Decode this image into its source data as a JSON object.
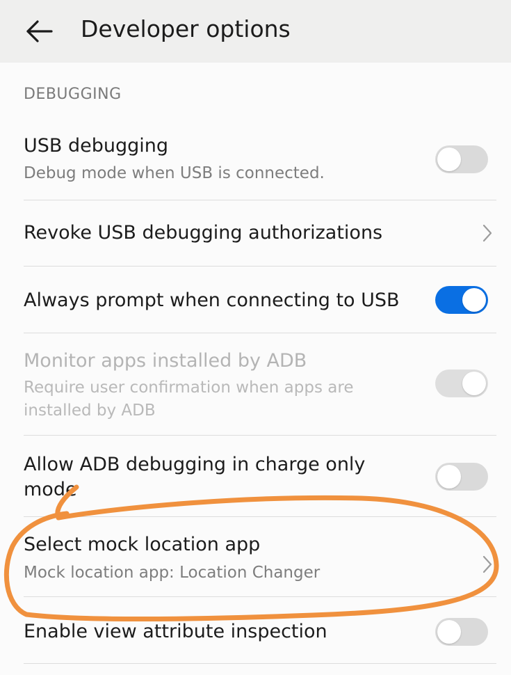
{
  "header": {
    "title": "Developer options",
    "back_icon": "arrow-left-icon"
  },
  "section": {
    "label": "DEBUGGING"
  },
  "rows": [
    {
      "title": "USB debugging",
      "subtitle": "Debug mode when USB is connected.",
      "control": "toggle",
      "state": "off"
    },
    {
      "title": "Revoke USB debugging authorizations",
      "control": "chevron"
    },
    {
      "title": "Always prompt when connecting to USB",
      "control": "toggle",
      "state": "on"
    },
    {
      "title": "Monitor apps installed by ADB",
      "subtitle_line1": "Require user confirmation when apps are",
      "subtitle_line2": "installed by ADB",
      "control": "toggle",
      "state": "on",
      "enabled": false
    },
    {
      "title_line1": "Allow ADB debugging in charge only",
      "title_line2": "mode",
      "control": "toggle",
      "state": "off"
    },
    {
      "title": "Select mock location app",
      "subtitle": "Mock location app: Location Changer",
      "control": "chevron"
    },
    {
      "title": "Enable view attribute inspection",
      "control": "toggle",
      "state": "off"
    }
  ],
  "colors": {
    "toggle_on": "#0a6fe3",
    "annotation": "#f0913e",
    "appbar": "#efefee"
  }
}
